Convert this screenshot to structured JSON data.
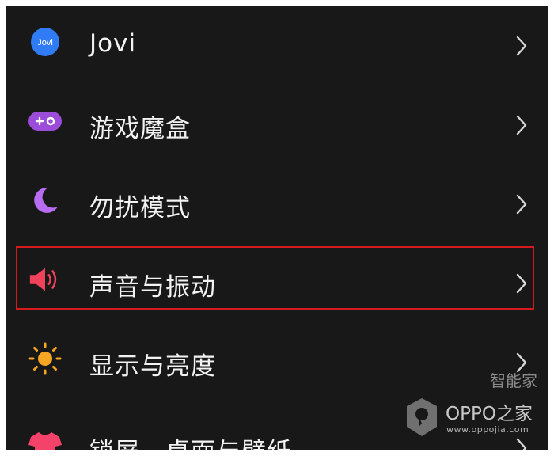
{
  "settings": {
    "items": [
      {
        "label": "Jovi",
        "icon": "jovi-icon",
        "icon_text": "Jovi",
        "icon_color": "#2f7cf6"
      },
      {
        "label": "游戏魔盒",
        "icon": "game-box-icon",
        "icon_color": "#9b4dd9"
      },
      {
        "label": "勿扰模式",
        "icon": "moon-icon",
        "icon_color": "#b86cf2"
      },
      {
        "label": "声音与振动",
        "icon": "speaker-icon",
        "icon_color": "#f0435b"
      },
      {
        "label": "显示与亮度",
        "icon": "sun-icon",
        "icon_color": "#f6a623"
      },
      {
        "label": "锁屏、桌面与壁纸",
        "icon": "tshirt-icon",
        "icon_color": "#f5426b"
      }
    ]
  },
  "highlight": {
    "target": "声音与振动",
    "color": "#d51a1f"
  },
  "watermark": {
    "title": "OPPO之家",
    "url": "www.oppojia.com",
    "partial_text": "智能家"
  }
}
